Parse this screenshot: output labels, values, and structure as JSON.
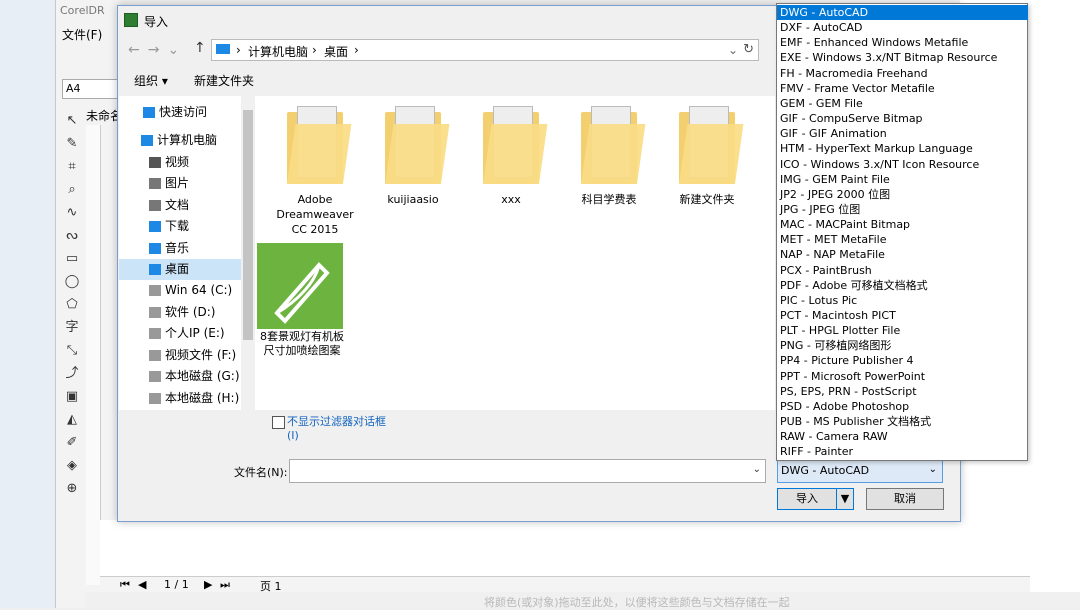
{
  "app": {
    "title": "CorelDR",
    "menu_file": "文件(F)",
    "page_size": "A4",
    "doc_tab": "未命名",
    "page_count": "1 / 1",
    "page_tab": "页 1",
    "status_hint": "将颜色(或对象)拖动至此处，以便将这些颜色与文档存储在一起"
  },
  "dialog": {
    "title": "导入",
    "breadcrumb": [
      "计算机电脑",
      "桌面"
    ],
    "organize": "组织 ▾",
    "new_folder": "新建文件夹",
    "nav_items": [
      {
        "label": "快速访问",
        "icon": "star-icon"
      },
      {
        "label": "计算机电脑",
        "icon": "computer-icon"
      },
      {
        "label": "视频",
        "icon": "video-icon"
      },
      {
        "label": "图片",
        "icon": "picture-icon"
      },
      {
        "label": "文档",
        "icon": "document-icon"
      },
      {
        "label": "下载",
        "icon": "download-icon"
      },
      {
        "label": "音乐",
        "icon": "music-icon"
      },
      {
        "label": "桌面",
        "icon": "desktop-icon"
      },
      {
        "label": "Win 64 (C:)",
        "icon": "drive-icon"
      },
      {
        "label": "软件 (D:)",
        "icon": "drive-icon"
      },
      {
        "label": "个人IP (E:)",
        "icon": "drive-icon"
      },
      {
        "label": "视频文件 (F:)",
        "icon": "drive-icon"
      },
      {
        "label": "本地磁盘 (G:)",
        "icon": "drive-icon"
      },
      {
        "label": "本地磁盘 (H:)",
        "icon": "drive-icon"
      }
    ],
    "files": [
      {
        "name": "Adobe Dreamweaver CC 2015",
        "type": "folder"
      },
      {
        "name": "kuijiaasio",
        "type": "folder"
      },
      {
        "name": "xxx",
        "type": "folder"
      },
      {
        "name": "科目学费表",
        "type": "folder"
      },
      {
        "name": "新建文件夹",
        "type": "folder"
      },
      {
        "name": "8套景观灯有机板尺寸加喷绘图案",
        "type": "cdr"
      }
    ],
    "checkbox_label_1": "不显示过滤器对话框",
    "checkbox_label_2": "(I)",
    "filename_label": "文件名(N):",
    "filename_value": "",
    "filetype_selected": "DWG - AutoCAD",
    "import_button": "导入",
    "cancel_button": "取消",
    "filetype_options": [
      "DWG - AutoCAD",
      "DXF - AutoCAD",
      "EMF - Enhanced Windows Metafile",
      "EXE - Windows 3.x/NT Bitmap Resource",
      "FH - Macromedia Freehand",
      "FMV - Frame Vector Metafile",
      "GEM - GEM File",
      "GIF - CompuServe Bitmap",
      "GIF - GIF Animation",
      "HTM - HyperText Markup Language",
      "ICO - Windows 3.x/NT Icon Resource",
      "IMG - GEM Paint File",
      "JP2 - JPEG 2000 位图",
      "JPG - JPEG 位图",
      "MAC - MACPaint Bitmap",
      "MET - MET MetaFile",
      "NAP - NAP MetaFile",
      "PCX - PaintBrush",
      "PDF - Adobe 可移植文档格式",
      "PIC - Lotus Pic",
      "PCT - Macintosh PICT",
      "PLT - HPGL Plotter File",
      "PNG - 可移植网络图形",
      "PP4 - Picture Publisher 4",
      "PPT - Microsoft PowerPoint",
      "PS, EPS,  PRN - PostScript",
      "PSD - Adobe Photoshop",
      "PUB - MS Publisher 文档格式",
      "RAW - Camera RAW",
      "RIFF - Painter"
    ]
  }
}
